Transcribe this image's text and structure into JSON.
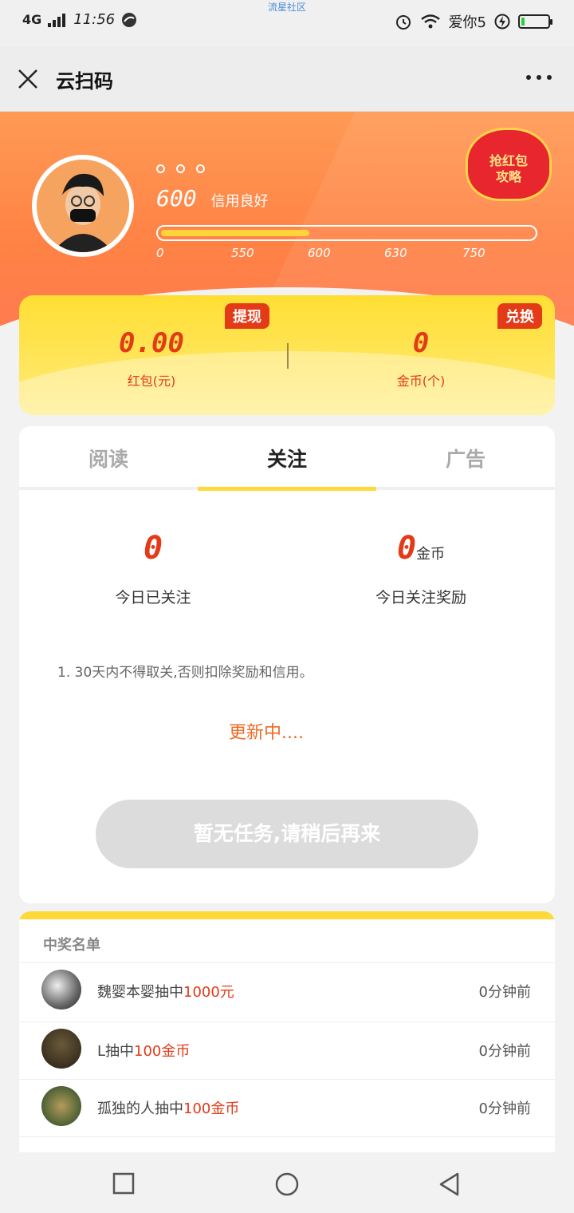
{
  "status_bar": {
    "network": "4G",
    "time": "11:56",
    "watermark": "流星社区",
    "carrier": "爱你5"
  },
  "header": {
    "title": "云扫码"
  },
  "profile": {
    "dots": "。。。",
    "credit_score": "600",
    "credit_status": "信用良好",
    "credit_progress_pct": 40,
    "ticks": [
      "0",
      "550",
      "600",
      "630",
      "750"
    ],
    "red_packet_promo": "抢红包攻略"
  },
  "wallet": {
    "withdraw_label": "提现",
    "exchange_label": "兑换",
    "red_packet_value": "0.00",
    "red_packet_label": "红包(元)",
    "coins_value": "0",
    "coins_label": "金币(个)"
  },
  "tabs": [
    {
      "label": "阅读",
      "active": false
    },
    {
      "label": "关注",
      "active": true
    },
    {
      "label": "广告",
      "active": false
    }
  ],
  "follow": {
    "followed_today_value": "0",
    "followed_today_label": "今日已关注",
    "reward_today_value": "0",
    "reward_unit": "金币",
    "reward_today_label": "今日关注奖励",
    "rule": "1. 30天内不得取关,否则扣除奖励和信用。",
    "updating": "更新中....",
    "empty_button": "暂无任务,请稍后再来"
  },
  "winners": {
    "heading": "中奖名单",
    "rows": [
      {
        "name": "魏婴本婴抽中",
        "prize": "1000元",
        "time": "0分钟前"
      },
      {
        "name": "L抽中",
        "prize": "100金币",
        "time": "0分钟前"
      },
      {
        "name": "孤独的人抽中",
        "prize": "100金币",
        "time": "0分钟前"
      }
    ]
  },
  "colors": {
    "accent_orange": "#ff8245",
    "accent_yellow": "#ffd93a",
    "accent_red": "#e33a18"
  }
}
